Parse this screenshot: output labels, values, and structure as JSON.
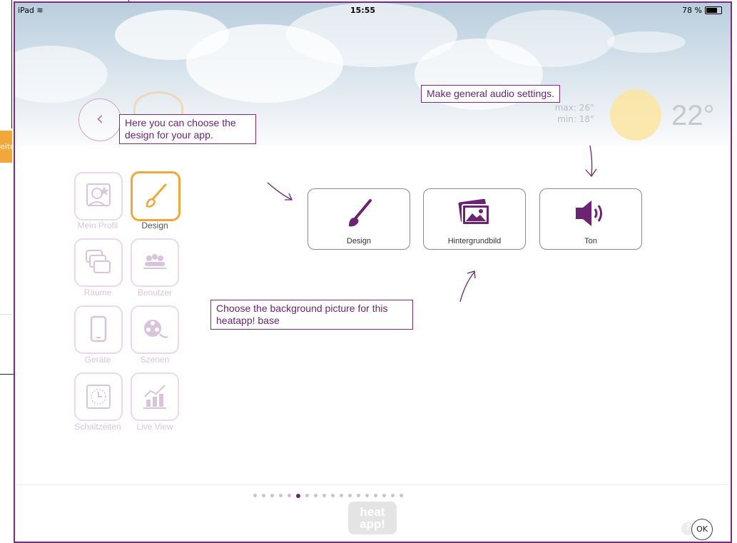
{
  "status_bar": {
    "device": "iPad",
    "time": "15:55",
    "battery": "78 %"
  },
  "edge_tab": "eite",
  "weather": {
    "max": "max: 26°",
    "min": "min: 18°",
    "temperature": "22°"
  },
  "back_glyph": "‹",
  "sidebar": {
    "items": [
      {
        "label": "Mein Profil",
        "icon": "profile-icon"
      },
      {
        "label": "Design",
        "icon": "brush-icon",
        "active": true
      },
      {
        "label": "Räume",
        "icon": "rooms-icon"
      },
      {
        "label": "Benutzer",
        "icon": "users-icon"
      },
      {
        "label": "Geräte",
        "icon": "device-icon"
      },
      {
        "label": "Szenen",
        "icon": "film-reel-icon"
      },
      {
        "label": "Schaltzeiten",
        "icon": "clock-icon"
      },
      {
        "label": "Live View",
        "icon": "chart-icon"
      }
    ]
  },
  "main": {
    "buttons": [
      {
        "label": "Design",
        "icon": "brush-icon"
      },
      {
        "label": "Hintergrundbild",
        "icon": "pictures-icon"
      },
      {
        "label": "Ton",
        "icon": "speaker-icon"
      }
    ]
  },
  "callouts": {
    "design": "Here you can choose the design for your app.",
    "audio": "Make general audio settings.",
    "background": "Choose the background picture for this heatapp! base"
  },
  "pagination": {
    "total": 18,
    "current": 5
  },
  "logo": {
    "line1": "heat",
    "line2": "app!"
  },
  "footer": {
    "help": "?",
    "ok": "OK"
  },
  "colors": {
    "accent": "#6a2472",
    "active_border": "#f2a73a",
    "frame": "#7a2c82"
  }
}
